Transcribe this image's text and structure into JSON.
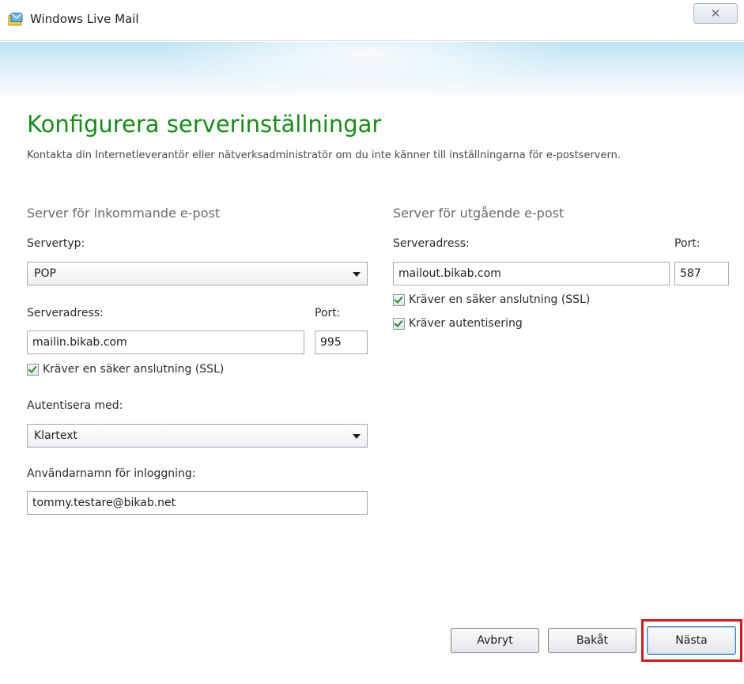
{
  "window": {
    "title": "Windows Live Mail",
    "close_label": "✕"
  },
  "page": {
    "heading": "Konfigurera serverinställningar",
    "description": "Kontakta din Internetleverantör eller nätverksadministratör om du inte känner till inställningarna för e-postservern."
  },
  "incoming": {
    "section_title": "Server för inkommande e-post",
    "server_type_label": "Servertyp:",
    "server_type_value": "POP",
    "server_address_label": "Serveradress:",
    "server_address_value": "mailin.bikab.com",
    "port_label": "Port:",
    "port_value": "995",
    "ssl_label": "Kräver en säker anslutning (SSL)",
    "ssl_checked": true,
    "auth_label": "Autentisera med:",
    "auth_value": "Klartext",
    "username_label": "Användarnamn för inloggning:",
    "username_value": "tommy.testare@bikab.net"
  },
  "outgoing": {
    "section_title": "Server för utgående e-post",
    "server_address_label": "Serveradress:",
    "server_address_value": "mailout.bikab.com",
    "port_label": "Port:",
    "port_value": "587",
    "ssl_label": "Kräver en säker anslutning (SSL)",
    "ssl_checked": true,
    "auth_required_label": "Kräver autentisering",
    "auth_required_checked": true
  },
  "buttons": {
    "cancel": "Avbryt",
    "back": "Bakåt",
    "next": "Nästa"
  },
  "colors": {
    "heading": "#1a8a1a",
    "highlight": "#d11b1b"
  }
}
